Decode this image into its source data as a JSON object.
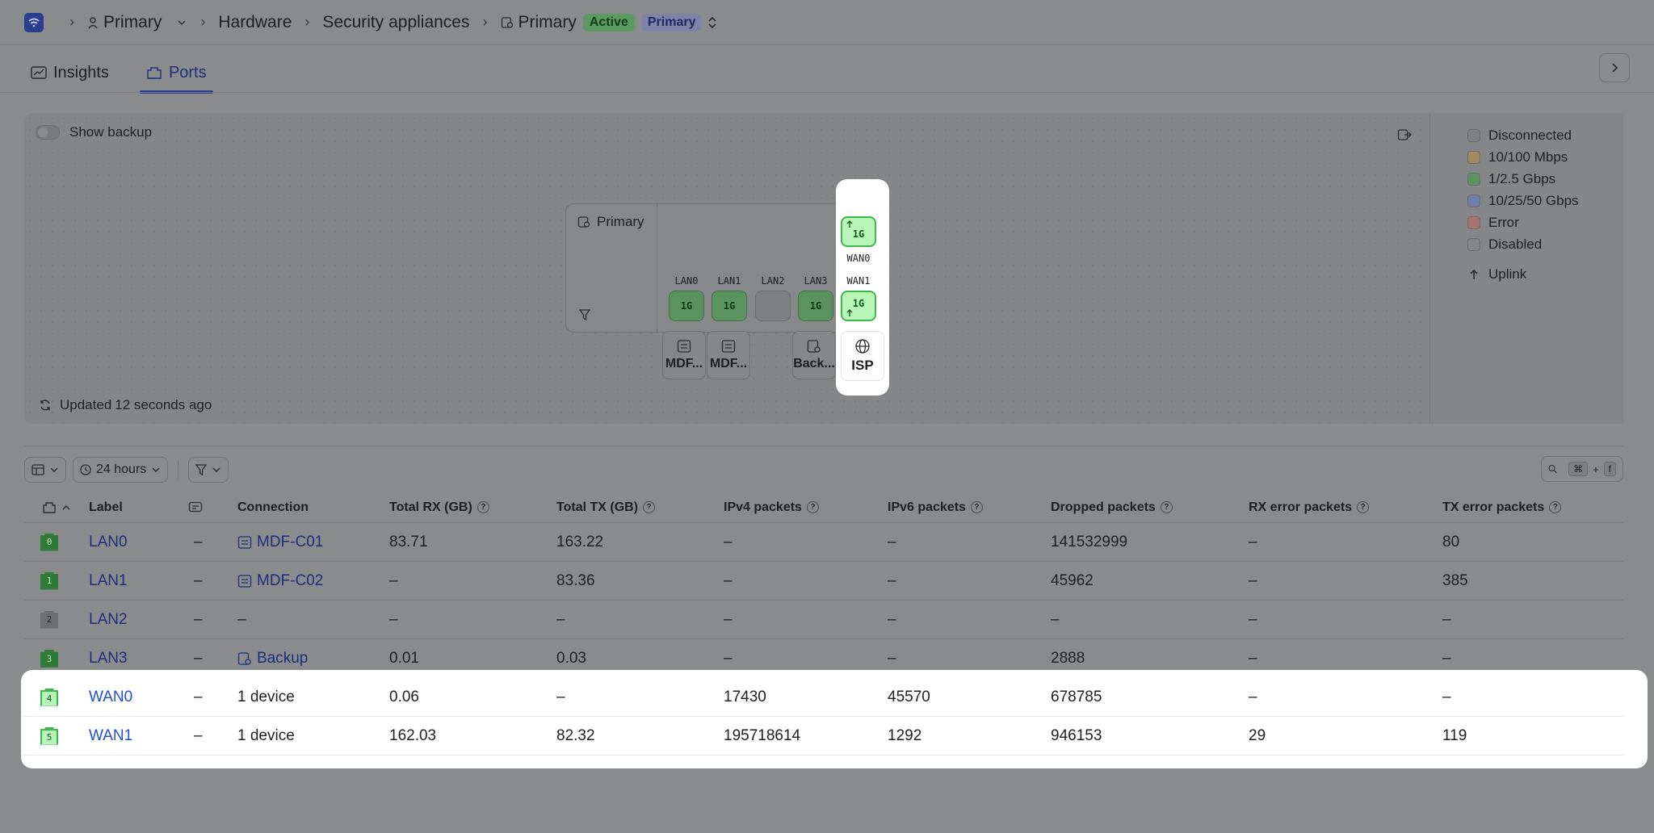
{
  "breadcrumb": {
    "org": "Primary",
    "section": "Hardware",
    "category": "Security appliances",
    "device": "Primary",
    "status_badge": "Active",
    "role_badge": "Primary"
  },
  "tabs": [
    {
      "label": "Insights",
      "icon": "insights-icon",
      "active": false
    },
    {
      "label": "Ports",
      "icon": "ports-icon",
      "active": true
    }
  ],
  "topology": {
    "show_backup_label": "Show backup",
    "updated_prefix": "Updated",
    "updated_value": "12 seconds ago",
    "device_name": "Primary",
    "ports": [
      {
        "name": "LAN0",
        "speed": "1G",
        "state": "connected"
      },
      {
        "name": "LAN1",
        "speed": "1G",
        "state": "connected"
      },
      {
        "name": "LAN2",
        "speed": "",
        "state": "disconnected"
      },
      {
        "name": "LAN3",
        "speed": "1G",
        "state": "connected"
      },
      {
        "name": "WAN0",
        "speed": "1G",
        "state": "uplink"
      },
      {
        "name": "WAN1",
        "speed": "1G",
        "state": "uplink"
      }
    ],
    "connections": [
      {
        "label": "MDF..."
      },
      {
        "label": "MDF..."
      },
      {
        "label": "Back..."
      },
      {
        "label": "ISP"
      }
    ]
  },
  "legend": {
    "items": [
      {
        "label": "Disconnected",
        "color": "#7e8084"
      },
      {
        "label": "10/100 Mbps",
        "color": "#a38a5e"
      },
      {
        "label": "1/2.5 Gbps",
        "color": "#5b9360"
      },
      {
        "label": "10/25/50 Gbps",
        "color": "#6d7fa8"
      },
      {
        "label": "Error",
        "color": "#a8736e"
      },
      {
        "label": "Disabled",
        "color": "#858687"
      }
    ],
    "uplink_label": "Uplink"
  },
  "toolbar": {
    "time_range": "24 hours",
    "search_shortcut_mod": "⌘",
    "search_shortcut_plus": "+",
    "search_shortcut_key": "f"
  },
  "table": {
    "columns": [
      "Label",
      "Connection",
      "Total RX (GB)",
      "Total TX (GB)",
      "IPv4 packets",
      "IPv6 packets",
      "Dropped packets",
      "RX error packets",
      "TX error packets"
    ],
    "rows": [
      {
        "num": "0",
        "label": "LAN0",
        "desc": "–",
        "connection": "MDF-C01",
        "rx": "83.71",
        "tx": "163.22",
        "ipv4": "–",
        "ipv6": "–",
        "dropped": "141532999",
        "rxerr": "–",
        "txerr": "80"
      },
      {
        "num": "1",
        "label": "LAN1",
        "desc": "–",
        "connection": "MDF-C02",
        "rx": "–",
        "tx": "83.36",
        "ipv4": "–",
        "ipv6": "–",
        "dropped": "45962",
        "rxerr": "–",
        "txerr": "385"
      },
      {
        "num": "2",
        "label": "LAN2",
        "desc": "–",
        "connection": "–",
        "rx": "–",
        "tx": "–",
        "ipv4": "–",
        "ipv6": "–",
        "dropped": "–",
        "rxerr": "–",
        "txerr": "–"
      },
      {
        "num": "3",
        "label": "LAN3",
        "desc": "–",
        "connection": "Backup",
        "rx": "0.01",
        "tx": "0.03",
        "ipv4": "–",
        "ipv6": "–",
        "dropped": "2888",
        "rxerr": "–",
        "txerr": "–"
      },
      {
        "num": "4",
        "label": "WAN0",
        "desc": "–",
        "connection": "1 device",
        "rx": "0.06",
        "tx": "–",
        "ipv4": "17430",
        "ipv6": "45570",
        "dropped": "678785",
        "rxerr": "–",
        "txerr": "–"
      },
      {
        "num": "5",
        "label": "WAN1",
        "desc": "–",
        "connection": "1 device",
        "rx": "162.03",
        "tx": "82.32",
        "ipv4": "195718614",
        "ipv6": "1292",
        "dropped": "946153",
        "rxerr": "29",
        "txerr": "119"
      }
    ]
  }
}
